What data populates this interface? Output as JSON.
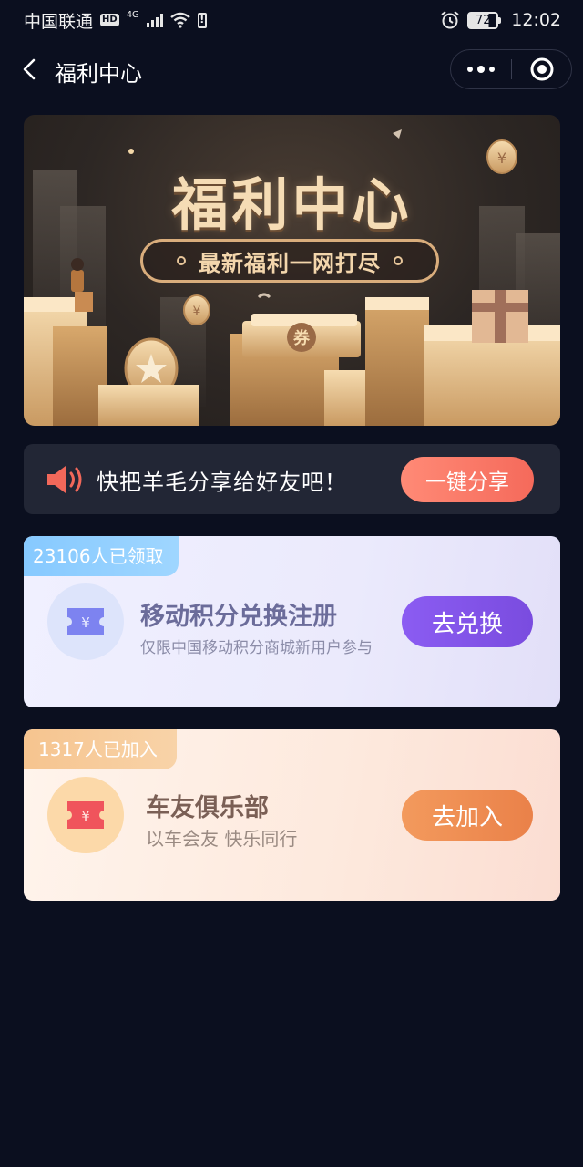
{
  "status_bar": {
    "carrier": "中国联通",
    "hd": "HD",
    "network": "4G",
    "battery_level": "72",
    "time": "12:02"
  },
  "nav": {
    "title": "福利中心"
  },
  "banner": {
    "heading": "福利中心",
    "tagline": "最新福利一网打尽",
    "coin_symbol": "¥",
    "ticket_symbol": "券"
  },
  "share": {
    "text": "快把羊毛分享给好友吧！",
    "button_label": "一键分享"
  },
  "cards": [
    {
      "badge": "23106人已领取",
      "title": "移动积分兑换注册",
      "subtitle": "仅限中国移动积分商城新用户参与",
      "button_label": "去兑换",
      "icon_symbol": "¥",
      "accent": "#7a4cdf"
    },
    {
      "badge": "1317人已加入",
      "title": "车友俱乐部",
      "subtitle": "以车会友  快乐同行",
      "button_label": "去加入",
      "icon_symbol": "¥",
      "accent": "#ea8149"
    }
  ],
  "colors": {
    "background": "#0b0f1f",
    "share_button": "#f56a5b"
  }
}
